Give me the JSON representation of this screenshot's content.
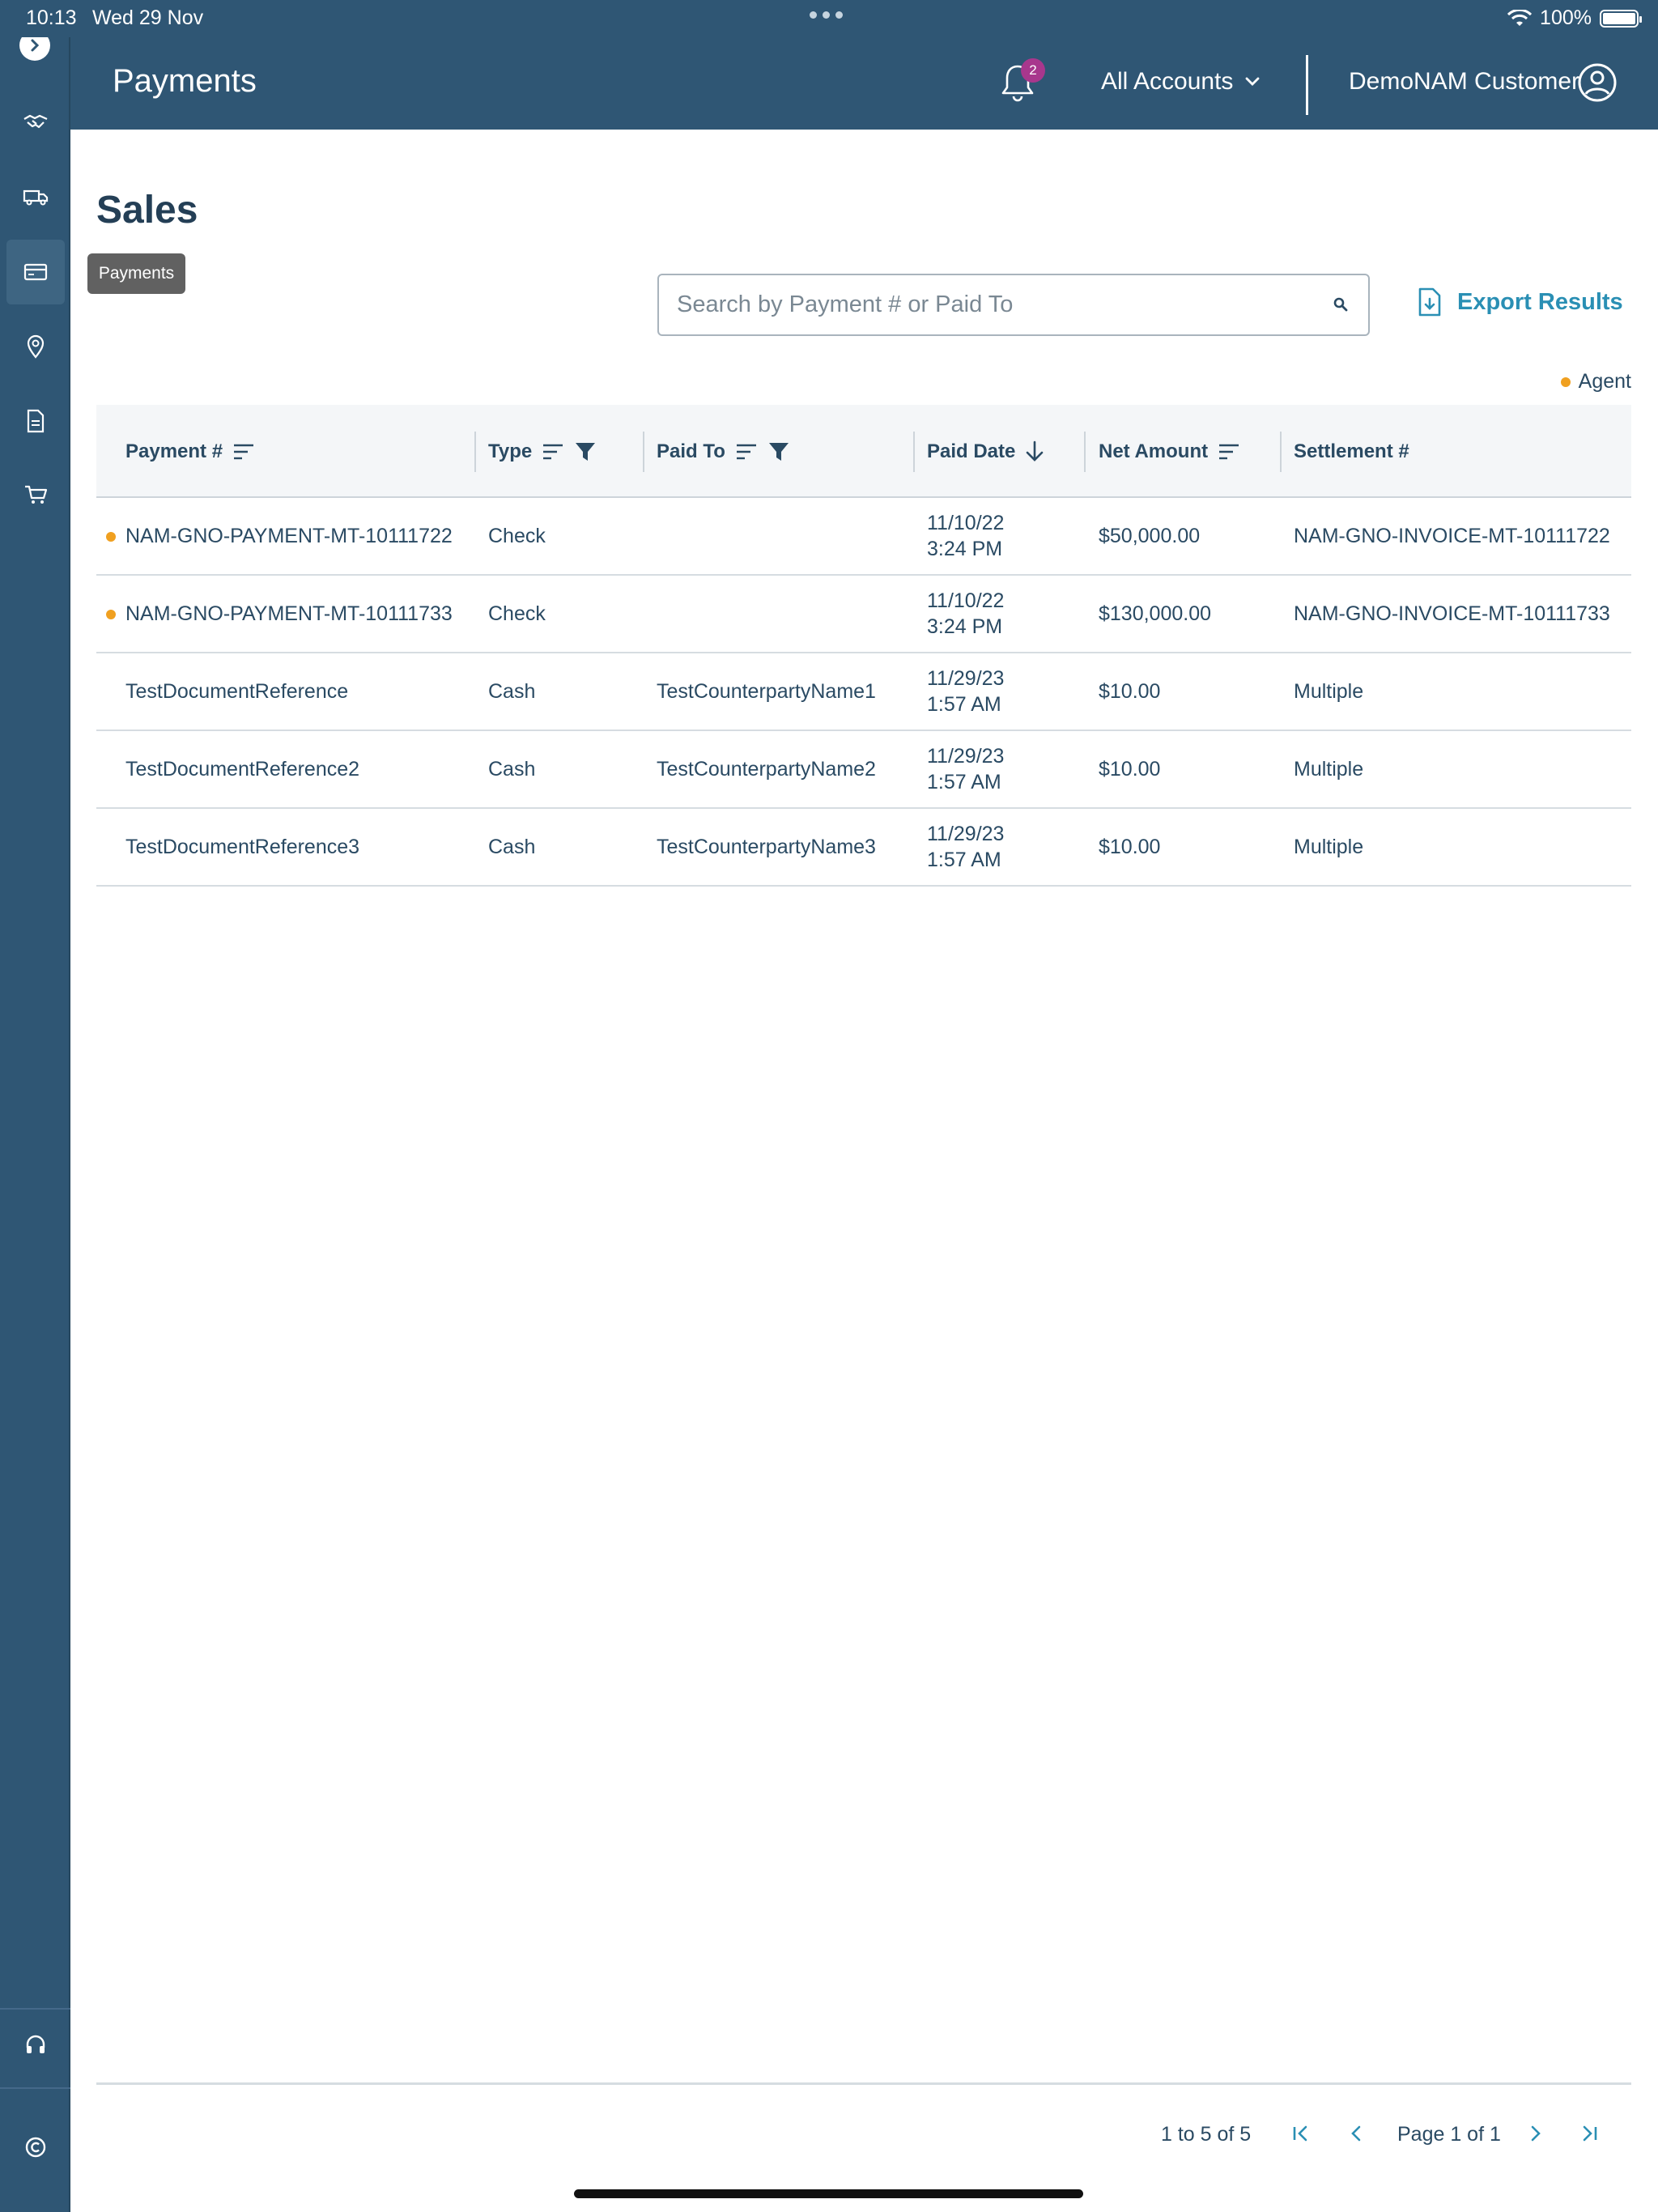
{
  "status_bar": {
    "time": "10:13",
    "date": "Wed 29 Nov",
    "battery": "100%"
  },
  "sidebar": {
    "tooltip": "Payments",
    "items": [
      {
        "icon": "handshake-icon"
      },
      {
        "icon": "truck-icon"
      },
      {
        "icon": "credit-card-icon",
        "active": true
      },
      {
        "icon": "location-pin-icon"
      },
      {
        "icon": "document-icon"
      },
      {
        "icon": "cart-icon"
      },
      {
        "icon": "headset-icon"
      },
      {
        "icon": "copyright-icon"
      }
    ]
  },
  "header": {
    "title": "Payments",
    "notification_count": "2",
    "accounts_label": "All Accounts",
    "user_name": "DemoNAM Customer"
  },
  "content": {
    "title": "Sales",
    "search_placeholder": "Search by Payment # or Paid To",
    "export_label": "Export Results",
    "legend_label": "Agent",
    "legend_color": "#f0a020"
  },
  "table": {
    "columns": [
      {
        "label": "Payment #",
        "sort": true,
        "filter": false
      },
      {
        "label": "Type",
        "sort": true,
        "filter": true
      },
      {
        "label": "Paid To",
        "sort": true,
        "filter": true
      },
      {
        "label": "Paid Date",
        "sort_direction": "descending"
      },
      {
        "label": "Net Amount",
        "sort": true,
        "filter": false
      },
      {
        "label": "Settlement #",
        "sort": false,
        "filter": false
      }
    ],
    "rows": [
      {
        "agent": true,
        "payment": "NAM-GNO-PAYMENT-MT-10111722",
        "type": "Check",
        "paid_to": "",
        "date": "11/10/22",
        "time": "3:24 PM",
        "amount": "$50,000.00",
        "settlement": "NAM-GNO-INVOICE-MT-10111722"
      },
      {
        "agent": true,
        "payment": "NAM-GNO-PAYMENT-MT-10111733",
        "type": "Check",
        "paid_to": "",
        "date": "11/10/22",
        "time": "3:24 PM",
        "amount": "$130,000.00",
        "settlement": "NAM-GNO-INVOICE-MT-10111733"
      },
      {
        "agent": false,
        "payment": "TestDocumentReference",
        "type": "Cash",
        "paid_to": "TestCounterpartyName1",
        "date": "11/29/23",
        "time": "1:57 AM",
        "amount": "$10.00",
        "settlement": "Multiple"
      },
      {
        "agent": false,
        "payment": "TestDocumentReference2",
        "type": "Cash",
        "paid_to": "TestCounterpartyName2",
        "date": "11/29/23",
        "time": "1:57 AM",
        "amount": "$10.00",
        "settlement": "Multiple"
      },
      {
        "agent": false,
        "payment": "TestDocumentReference3",
        "type": "Cash",
        "paid_to": "TestCounterpartyName3",
        "date": "11/29/23",
        "time": "1:57 AM",
        "amount": "$10.00",
        "settlement": "Multiple"
      }
    ]
  },
  "pagination": {
    "range": "1 to 5 of 5",
    "page_label": "Page 1 of 1"
  },
  "colors": {
    "header_bg": "#2f5674",
    "accent": "#2a8fb4",
    "badge": "#a8378d"
  }
}
